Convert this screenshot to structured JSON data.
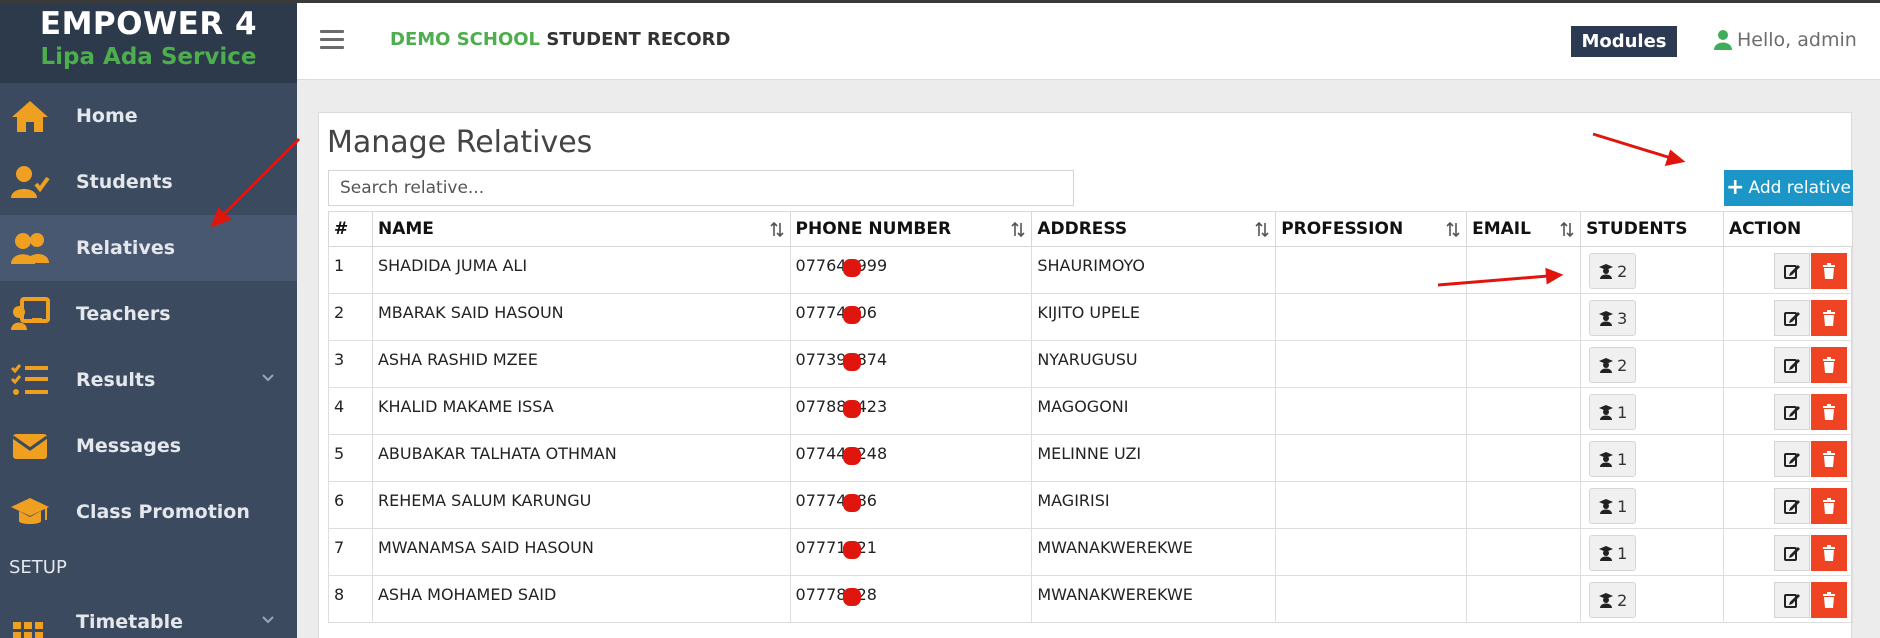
{
  "brand": {
    "title": "EMPOWER 4",
    "subtitle": "Lipa Ada Service"
  },
  "sidebar": {
    "items": [
      {
        "label": "Home",
        "icon": "home-icon"
      },
      {
        "label": "Students",
        "icon": "user-check-icon"
      },
      {
        "label": "Relatives",
        "icon": "users-icon",
        "active": true
      },
      {
        "label": "Teachers",
        "icon": "chalkboard-teacher-icon"
      },
      {
        "label": "Results",
        "icon": "list-check-icon",
        "has_submenu": true
      },
      {
        "label": "Messages",
        "icon": "envelope-icon"
      },
      {
        "label": "Class Promotion",
        "icon": "graduation-cap-icon"
      }
    ],
    "section_label": "SETUP",
    "setup_items": [
      {
        "label": "Timetable",
        "icon": "calendar-grid-icon",
        "has_submenu": true
      }
    ]
  },
  "header": {
    "title_green": "DEMO SCHOOL",
    "title_dark": "STUDENT RECORD",
    "modules_label": "Modules",
    "user_greeting": "Hello, admin"
  },
  "main": {
    "page_title": "Manage Relatives",
    "search_placeholder": "Search relative...",
    "add_button_label": "Add relative",
    "columns": [
      "#",
      "NAME",
      "PHONE NUMBER",
      "ADDRESS",
      "PROFESSION",
      "EMAIL",
      "STUDENTS",
      "ACTION"
    ],
    "rows": [
      {
        "num": "1",
        "name": "SHADIDA JUMA ALI",
        "phone": "077643999",
        "address": "SHAURIMOYO",
        "profession": "",
        "email": "",
        "students": "2"
      },
      {
        "num": "2",
        "name": "MBARAK SAID HASOUN",
        "phone": "07774706",
        "address": "KIJITO UPELE",
        "profession": "",
        "email": "",
        "students": "3"
      },
      {
        "num": "3",
        "name": "ASHA RASHID MZEE",
        "phone": "077391874",
        "address": "NYARUGUSU",
        "profession": "",
        "email": "",
        "students": "2"
      },
      {
        "num": "4",
        "name": "KHALID MAKAME ISSA",
        "phone": "077886423",
        "address": "MAGOGONI",
        "profession": "",
        "email": "",
        "students": "1"
      },
      {
        "num": "5",
        "name": "ABUBAKAR TALHATA OTHMAN",
        "phone": "077449248",
        "address": "MELINNE UZI",
        "profession": "",
        "email": "",
        "students": "1"
      },
      {
        "num": "6",
        "name": "REHEMA SALUM KARUNGU",
        "phone": "07774886",
        "address": "MAGIRISI",
        "profession": "",
        "email": "",
        "students": "1"
      },
      {
        "num": "7",
        "name": "MWANAMSA SAID HASOUN",
        "phone": "07771421",
        "address": "MWANAKWEREKWE",
        "profession": "",
        "email": "",
        "students": "1"
      },
      {
        "num": "8",
        "name": "ASHA MOHAMED SAID",
        "phone": "07778528",
        "address": "MWANAKWEREKWE",
        "profession": "",
        "email": "",
        "students": "2"
      }
    ]
  },
  "colors": {
    "sidebar_bg": "#3b4a5e",
    "brand_bg": "#2d3a4b",
    "accent_green": "#4cae4c",
    "nav_icon_orange": "#f0a020",
    "add_button_blue": "#1b96c6",
    "delete_red": "#ee4423",
    "annotation_red": "#e0160e"
  }
}
